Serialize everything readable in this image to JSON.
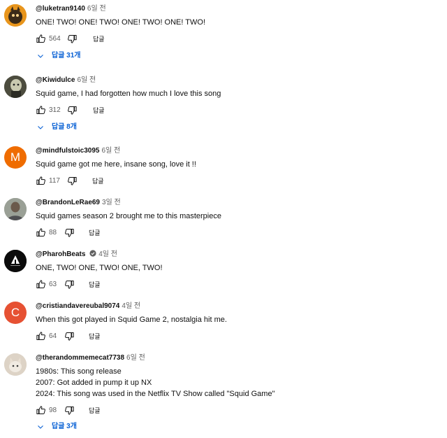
{
  "colors": {
    "link_blue": "#065fd4",
    "meta_gray": "#606060",
    "text": "#0f0f0f"
  },
  "ui": {
    "reply_label": "답글"
  },
  "comments": [
    {
      "author": "@luketran9140",
      "time": "6일 전",
      "lines": [
        "ONE! TWO! ONE! TWO! ONE! TWO! ONE! TWO!"
      ],
      "likes": "564",
      "replies_label": "답글 31개",
      "avatar": {
        "kind": "image",
        "icon": "animal-photo",
        "bg": "#f2a22a"
      }
    },
    {
      "author": "@Kiwidulce",
      "time": "6일 전",
      "lines": [
        "Squid game, I had forgotten how much I love this song"
      ],
      "likes": "312",
      "replies_label": "답글 8개",
      "avatar": {
        "kind": "image",
        "icon": "character-photo",
        "bg": "#5a5a4a"
      }
    },
    {
      "author": "@mindfulstoic3095",
      "time": "6일 전",
      "lines": [
        "Squid game got me here, insane song, love it !!"
      ],
      "likes": "117",
      "avatar": {
        "kind": "letter",
        "letter": "M",
        "bg": "#ef6c00"
      }
    },
    {
      "author": "@BrandonLeRae69",
      "time": "3일 전",
      "lines": [
        "Squid games season 2 brought me to this masterpiece"
      ],
      "likes": "88",
      "avatar": {
        "kind": "image",
        "icon": "person-photo",
        "bg": "#8a8f86"
      }
    },
    {
      "author": "@PharohBeats",
      "time": "4일 전",
      "verified": true,
      "lines": [
        "ONE, TWO! ONE, TWO! ONE, TWO!"
      ],
      "likes": "63",
      "avatar": {
        "kind": "image",
        "icon": "pharoh-logo",
        "bg": "#0b0b0b"
      }
    },
    {
      "author": "@cristiandavereubal9074",
      "time": "4일 전",
      "lines": [
        "When this got played in Squid Game 2, nostalgia hit me."
      ],
      "likes": "64",
      "avatar": {
        "kind": "letter",
        "letter": "C",
        "bg": "#e65133"
      }
    },
    {
      "author": "@therandommemecat7738",
      "time": "6일 전",
      "lines": [
        "1980s: This song release",
        "2007: Got added in pump it up NX",
        "2024: This song was used in the Netflix TV Show called \"Squid Game\""
      ],
      "likes": "98",
      "replies_label": "답글 3개",
      "avatar": {
        "kind": "image",
        "icon": "cat-photo",
        "bg": "#d9cfc2"
      }
    }
  ]
}
